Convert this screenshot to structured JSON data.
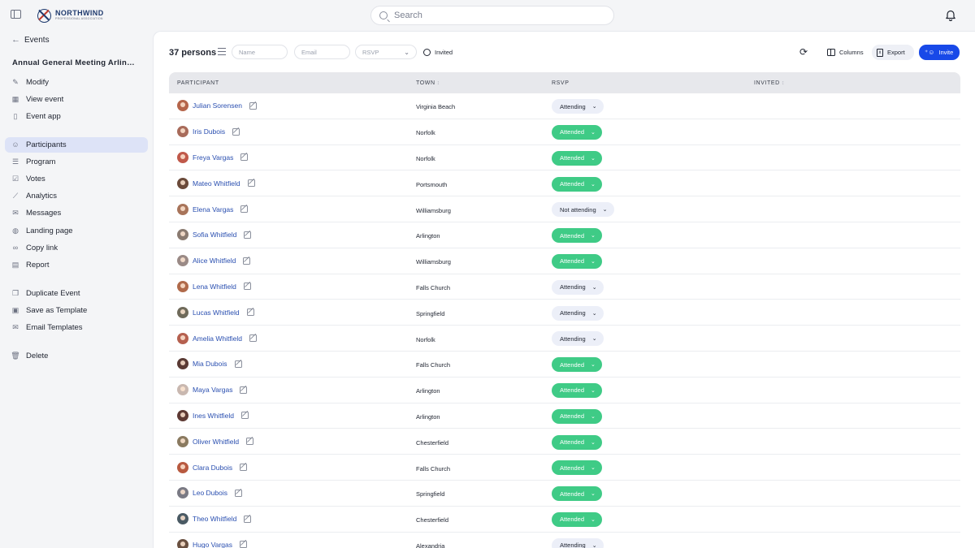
{
  "brand": {
    "name": "NORTHWIND",
    "tagline": "PROFESSIONAL ASSOCIATION"
  },
  "search": {
    "placeholder": "Search"
  },
  "sidebar": {
    "back_label": "Events",
    "event_title": "Annual General Meeting Arlington",
    "items": [
      {
        "label": "Modify",
        "icon": "pencil-icon"
      },
      {
        "label": "View event",
        "icon": "calendar-icon"
      },
      {
        "label": "Event app",
        "icon": "phone-icon"
      },
      {
        "label": "Participants",
        "icon": "people-icon",
        "active": true
      },
      {
        "label": "Program",
        "icon": "list-icon"
      },
      {
        "label": "Votes",
        "icon": "vote-icon"
      },
      {
        "label": "Analytics",
        "icon": "chart-icon"
      },
      {
        "label": "Messages",
        "icon": "mail-icon"
      },
      {
        "label": "Landing page",
        "icon": "globe-icon"
      },
      {
        "label": "Copy link",
        "icon": "link-icon"
      },
      {
        "label": "Report",
        "icon": "report-icon"
      },
      {
        "label": "Duplicate Event",
        "icon": "duplicate-icon"
      },
      {
        "label": "Save as Template",
        "icon": "template-icon"
      },
      {
        "label": "Email Templates",
        "icon": "email-template-icon"
      },
      {
        "label": "Delete",
        "icon": "trash-icon"
      }
    ]
  },
  "toolbar": {
    "count_label": "37 persons",
    "name_placeholder": "Name",
    "email_placeholder": "Email",
    "rsvp_placeholder": "RSVP",
    "invited_label": "Invited",
    "columns_label": "Columns",
    "export_label": "Export",
    "invite_label": "Invite"
  },
  "table": {
    "headers": {
      "participant": "PARTICIPANT",
      "town": "TOWN",
      "rsvp": "RSVP",
      "invited": "INVITED"
    },
    "rows": [
      {
        "name": "Julian Sorensen",
        "town": "Virginia Beach",
        "rsvp": "Attending",
        "avatar_color": "#b5654a"
      },
      {
        "name": "Iris Dubois",
        "town": "Norfolk",
        "rsvp": "Attended",
        "avatar_color": "#a86b5a"
      },
      {
        "name": "Freya Vargas",
        "town": "Norfolk",
        "rsvp": "Attended",
        "avatar_color": "#c0594a"
      },
      {
        "name": "Mateo Whitfield",
        "town": "Portsmouth",
        "rsvp": "Attended",
        "avatar_color": "#6b4a3a"
      },
      {
        "name": "Elena Vargas",
        "town": "Williamsburg",
        "rsvp": "Not attending",
        "avatar_color": "#a8745a"
      },
      {
        "name": "Sofia Whitfield",
        "town": "Arlington",
        "rsvp": "Attended",
        "avatar_color": "#8a7a70"
      },
      {
        "name": "Alice Whitfield",
        "town": "Williamsburg",
        "rsvp": "Attended",
        "avatar_color": "#9a8a86"
      },
      {
        "name": "Lena Whitfield",
        "town": "Falls Church",
        "rsvp": "Attending",
        "avatar_color": "#b06a4a"
      },
      {
        "name": "Lucas Whitfield",
        "town": "Springfield",
        "rsvp": "Attending",
        "avatar_color": "#6f6a5a"
      },
      {
        "name": "Amelia Whitfield",
        "town": "Norfolk",
        "rsvp": "Attending",
        "avatar_color": "#b5604f"
      },
      {
        "name": "Mia Dubois",
        "town": "Falls Church",
        "rsvp": "Attended",
        "avatar_color": "#5a3a34"
      },
      {
        "name": "Maya Vargas",
        "town": "Arlington",
        "rsvp": "Attended",
        "avatar_color": "#c9b8b0"
      },
      {
        "name": "Ines Whitfield",
        "town": "Arlington",
        "rsvp": "Attended",
        "avatar_color": "#5e3a34"
      },
      {
        "name": "Oliver Whitfield",
        "town": "Chesterfield",
        "rsvp": "Attended",
        "avatar_color": "#8a7a60"
      },
      {
        "name": "Clara Dubois",
        "town": "Falls Church",
        "rsvp": "Attended",
        "avatar_color": "#b85a40"
      },
      {
        "name": "Leo Dubois",
        "town": "Springfield",
        "rsvp": "Attended",
        "avatar_color": "#7a7a84"
      },
      {
        "name": "Theo Whitfield",
        "town": "Chesterfield",
        "rsvp": "Attended",
        "avatar_color": "#4a5a64"
      },
      {
        "name": "Hugo Vargas",
        "town": "Alexandria",
        "rsvp": "Attending",
        "avatar_color": "#6a5040"
      }
    ]
  },
  "colors": {
    "accent": "#1849e8",
    "attended": "#3fcb86",
    "active_nav": "#dde3f7",
    "link": "#2a4fb0"
  }
}
